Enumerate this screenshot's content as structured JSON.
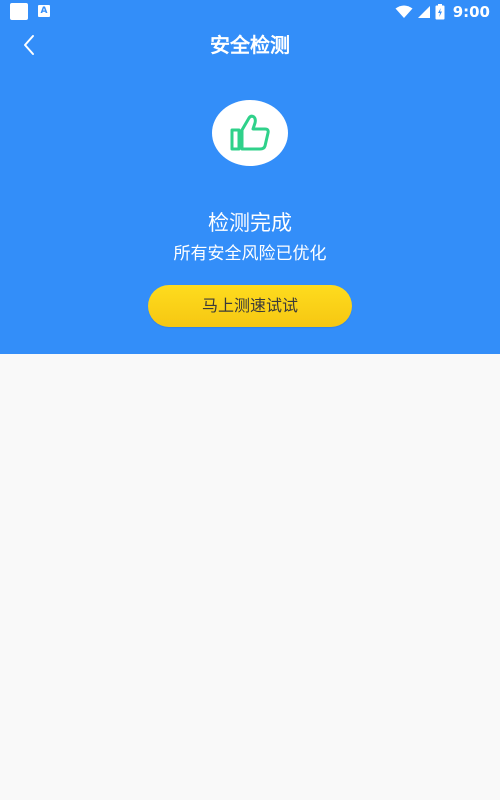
{
  "status_bar": {
    "time": "9:00",
    "left_icons": [
      "app-square-icon",
      "a-badge-icon"
    ],
    "right_icons": [
      "wifi-icon",
      "signal-icon",
      "battery-icon"
    ],
    "a_badge_text": "A"
  },
  "header": {
    "title": "安全检测",
    "back_icon": "chevron-left-icon"
  },
  "result": {
    "icon": "thumbs-up-icon",
    "title": "检测完成",
    "subtitle": "所有安全风险已优化"
  },
  "action": {
    "button_label": "马上测速试试"
  },
  "colors": {
    "hero_background": "#338ef9",
    "page_background": "#f9f9f9",
    "button_yellow": "#fcd31a",
    "icon_green": "#2fd18a"
  }
}
